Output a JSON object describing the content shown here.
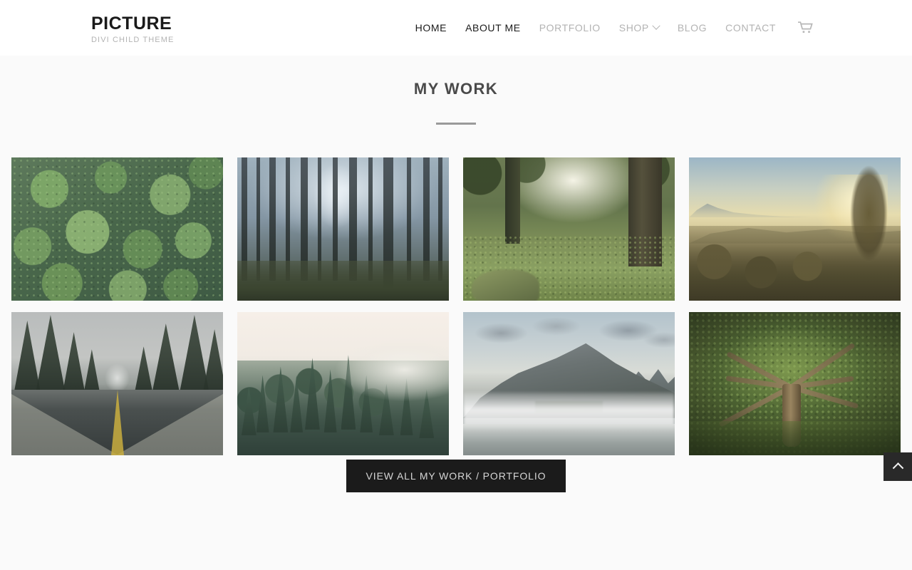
{
  "header": {
    "logo_title": "PICTURE",
    "logo_subtitle": "DIVI CHILD THEME",
    "nav": [
      {
        "label": "HOME",
        "active": true,
        "has_dropdown": false
      },
      {
        "label": "ABOUT ME",
        "active": true,
        "has_dropdown": false
      },
      {
        "label": "PORTFOLIO",
        "active": false,
        "has_dropdown": false
      },
      {
        "label": "SHOP",
        "active": false,
        "has_dropdown": true
      },
      {
        "label": "BLOG",
        "active": false,
        "has_dropdown": false
      },
      {
        "label": "CONTACT",
        "active": false,
        "has_dropdown": false
      }
    ],
    "cart_icon": "shopping-cart-icon"
  },
  "main": {
    "section_title": "MY WORK",
    "gallery": [
      {
        "alt": "Aerial view of dense green forest canopy",
        "scene": "s-canopy"
      },
      {
        "alt": "Misty blue-gray forest with tall trunks",
        "scene": "s-mistwood"
      },
      {
        "alt": "Sunlit forest floor with grass and large tree",
        "scene": "s-sunfloor"
      },
      {
        "alt": "Golden sunrise over hazy valley with cypress",
        "scene": "s-sunrise"
      },
      {
        "alt": "Wet road vanishing into fog between pines",
        "scene": "s-road"
      },
      {
        "alt": "Pine forest hillside shrouded in fog",
        "scene": "s-fogpine"
      },
      {
        "alt": "Mountain peak above misty lake",
        "scene": "s-mountain"
      },
      {
        "alt": "Sprawling oak tree in green forest",
        "scene": "s-oak"
      }
    ],
    "cta_label": "VIEW ALL MY WORK / PORTFOLIO"
  },
  "scroll_top": {
    "icon": "chevron-up-icon"
  },
  "colors": {
    "page_background": "#fafafa",
    "header_background": "#ffffff",
    "logo_text": "#1a1a1a",
    "logo_subtitle_text": "#b3b3b3",
    "nav_inactive": "#b3b3b3",
    "nav_active": "#1a1a1a",
    "title_text": "#4a4a4a",
    "divider": "#9a9a9a",
    "cta_background": "#1b1b1b",
    "cta_text": "#d6d6d6",
    "scroll_top_background": "#292929"
  }
}
